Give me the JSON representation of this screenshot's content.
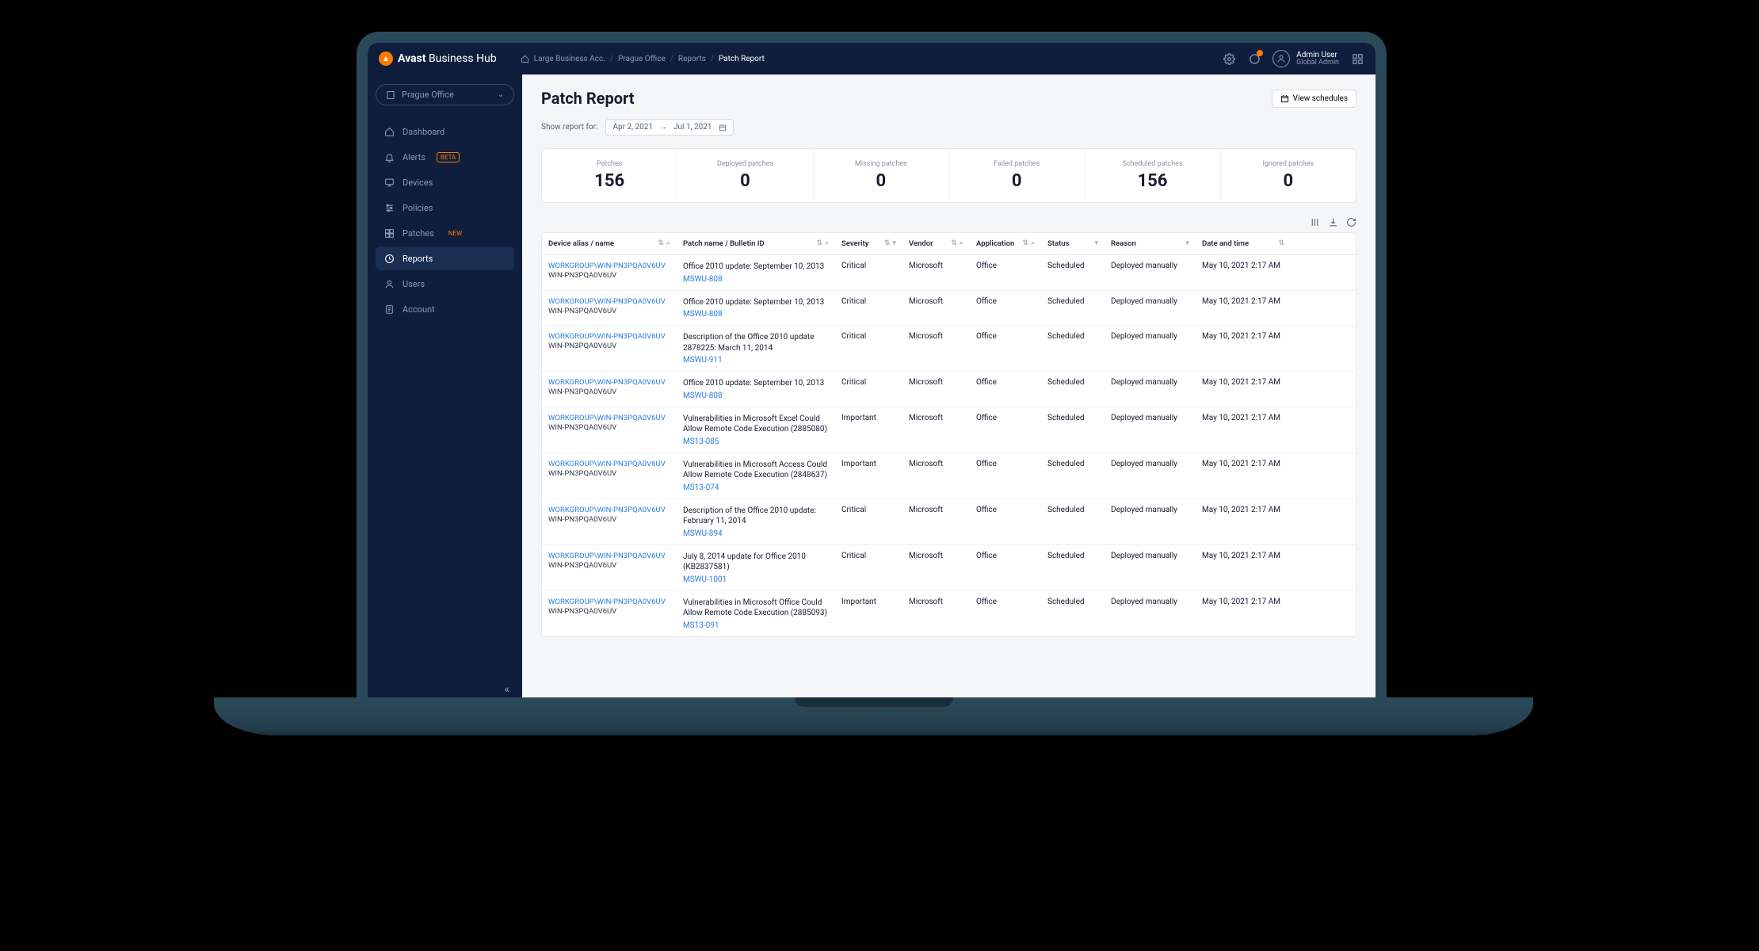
{
  "brand": {
    "bold": "Avast",
    "light": "Business Hub"
  },
  "breadcrumbs": {
    "items": [
      {
        "label": "Large Business Acc."
      },
      {
        "label": "Prague Office"
      },
      {
        "label": "Reports"
      },
      {
        "label": "Patch Report",
        "active": true
      }
    ]
  },
  "user": {
    "name": "Admin User",
    "role": "Global Admin"
  },
  "sidebar": {
    "site": "Prague Office",
    "items": [
      {
        "label": "Dashboard",
        "icon": "home"
      },
      {
        "label": "Alerts",
        "icon": "bell",
        "badge": "BETA",
        "badgeClass": "badge-beta"
      },
      {
        "label": "Devices",
        "icon": "monitor"
      },
      {
        "label": "Policies",
        "icon": "sliders"
      },
      {
        "label": "Patches",
        "icon": "grid",
        "badge": "NEW",
        "badgeClass": "badge-new"
      },
      {
        "label": "Reports",
        "icon": "clock",
        "active": true
      },
      {
        "label": "Users",
        "icon": "user"
      },
      {
        "label": "Account",
        "icon": "file"
      }
    ]
  },
  "page": {
    "title": "Patch Report",
    "viewSchedules": "View schedules",
    "showReportLabel": "Show report for:",
    "dateFrom": "Apr 2, 2021",
    "dateTo": "Jul 1, 2021"
  },
  "stats": [
    {
      "label": "Patches",
      "value": "156"
    },
    {
      "label": "Deployed patches",
      "value": "0"
    },
    {
      "label": "Missing patches",
      "value": "0"
    },
    {
      "label": "Failed patches",
      "value": "0"
    },
    {
      "label": "Scheduled patches",
      "value": "156"
    },
    {
      "label": "Ignored patches",
      "value": "0"
    }
  ],
  "columns": {
    "device": "Device alias / name",
    "patch": "Patch name / Bulletin ID",
    "severity": "Severity",
    "vendor": "Vendor",
    "application": "Application",
    "status": "Status",
    "reason": "Reason",
    "datetime": "Date and time"
  },
  "rows": [
    {
      "alias": "WORKGROUP\\WIN-PN3PQA0V6UV",
      "name": "WIN-PN3PQA0V6UV",
      "patch": "Office 2010 update: September 10, 2013",
      "bulletin": "MSWU-808",
      "severity": "Critical",
      "vendor": "Microsoft",
      "app": "Office",
      "status": "Scheduled",
      "reason": "Deployed manually",
      "datetime": "May 10, 2021 2:17 AM"
    },
    {
      "alias": "WORKGROUP\\WIN-PN3PQA0V6UV",
      "name": "WIN-PN3PQA0V6UV",
      "patch": "Office 2010 update: September 10, 2013",
      "bulletin": "MSWU-808",
      "severity": "Critical",
      "vendor": "Microsoft",
      "app": "Office",
      "status": "Scheduled",
      "reason": "Deployed manually",
      "datetime": "May 10, 2021 2:17 AM"
    },
    {
      "alias": "WORKGROUP\\WIN-PN3PQA0V6UV",
      "name": "WIN-PN3PQA0V6UV",
      "patch": "Description of the Office 2010 update 2878225: March 11, 2014",
      "bulletin": "MSWU-911",
      "severity": "Critical",
      "vendor": "Microsoft",
      "app": "Office",
      "status": "Scheduled",
      "reason": "Deployed manually",
      "datetime": "May 10, 2021 2:17 AM"
    },
    {
      "alias": "WORKGROUP\\WIN-PN3PQA0V6UV",
      "name": "WIN-PN3PQA0V6UV",
      "patch": "Office 2010 update: September 10, 2013",
      "bulletin": "MSWU-808",
      "severity": "Critical",
      "vendor": "Microsoft",
      "app": "Office",
      "status": "Scheduled",
      "reason": "Deployed manually",
      "datetime": "May 10, 2021 2:17 AM"
    },
    {
      "alias": "WORKGROUP\\WIN-PN3PQA0V6UV",
      "name": "WIN-PN3PQA0V6UV",
      "patch": "Vulnerabilities in Microsoft Excel Could Allow Remote Code Execution (2885080)",
      "bulletin": "MS13-085",
      "severity": "Important",
      "vendor": "Microsoft",
      "app": "Office",
      "status": "Scheduled",
      "reason": "Deployed manually",
      "datetime": "May 10, 2021 2:17 AM"
    },
    {
      "alias": "WORKGROUP\\WIN-PN3PQA0V6UV",
      "name": "WIN-PN3PQA0V6UV",
      "patch": "Vulnerabilities in Microsoft Access Could Allow Remote Code Execution (2848637)",
      "bulletin": "MS13-074",
      "severity": "Important",
      "vendor": "Microsoft",
      "app": "Office",
      "status": "Scheduled",
      "reason": "Deployed manually",
      "datetime": "May 10, 2021 2:17 AM"
    },
    {
      "alias": "WORKGROUP\\WIN-PN3PQA0V6UV",
      "name": "WIN-PN3PQA0V6UV",
      "patch": "Description of the Office 2010 update: February 11, 2014",
      "bulletin": "MSWU-894",
      "severity": "Critical",
      "vendor": "Microsoft",
      "app": "Office",
      "status": "Scheduled",
      "reason": "Deployed manually",
      "datetime": "May 10, 2021 2:17 AM"
    },
    {
      "alias": "WORKGROUP\\WIN-PN3PQA0V6UV",
      "name": "WIN-PN3PQA0V6UV",
      "patch": "July 8, 2014 update for Office 2010 (KB2837581)",
      "bulletin": "MSWU-1001",
      "severity": "Critical",
      "vendor": "Microsoft",
      "app": "Office",
      "status": "Scheduled",
      "reason": "Deployed manually",
      "datetime": "May 10, 2021 2:17 AM"
    },
    {
      "alias": "WORKGROUP\\WIN-PN3PQA0V6UV",
      "name": "WIN-PN3PQA0V6UV",
      "patch": "Vulnerabilities in Microsoft Office Could Allow Remote Code Execution (2885093)",
      "bulletin": "MS13-091",
      "severity": "Important",
      "vendor": "Microsoft",
      "app": "Office",
      "status": "Scheduled",
      "reason": "Deployed manually",
      "datetime": "May 10, 2021 2:17 AM"
    }
  ]
}
